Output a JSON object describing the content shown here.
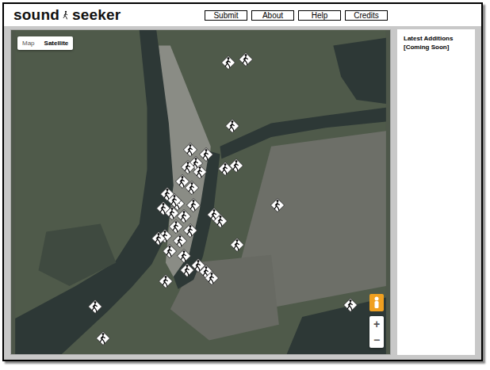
{
  "logo": {
    "left": "sound",
    "right": "seeker"
  },
  "nav": [
    "Submit",
    "About",
    "Help",
    "Credits"
  ],
  "map": {
    "types": [
      {
        "label": "Map",
        "selected": false
      },
      {
        "label": "Satellite",
        "selected": true
      }
    ],
    "zoom": [
      "+",
      "−"
    ]
  },
  "sidebar": {
    "title": "Latest Additions",
    "note": "[Coming Soon]"
  }
}
